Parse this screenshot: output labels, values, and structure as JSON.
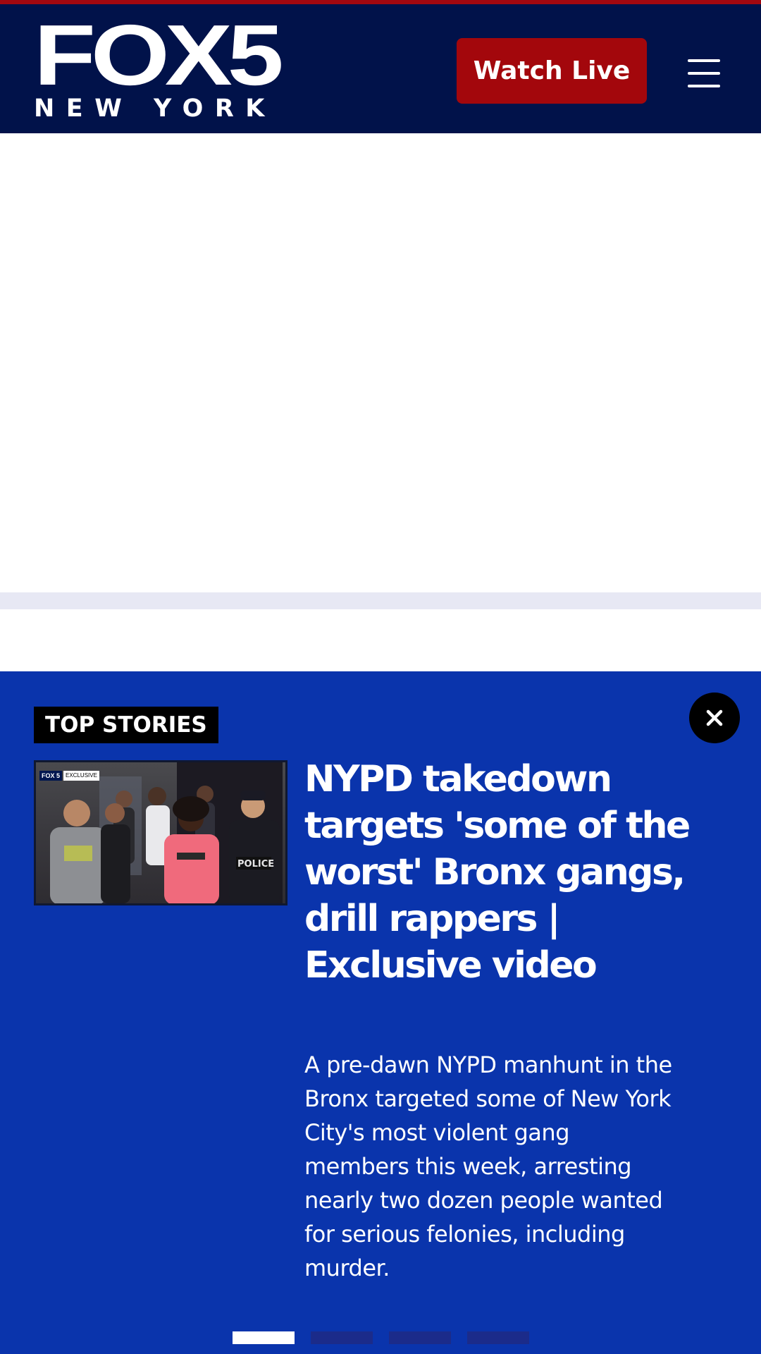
{
  "header": {
    "logo": {
      "main": "FOX5",
      "sub": "NEW YORK"
    },
    "watch_live_label": "Watch Live",
    "menu_icon": "hamburger-menu-icon",
    "background_color": "#01124a",
    "accent_color": "#a2080f"
  },
  "top_stories": {
    "badge": "TOP STORIES",
    "close_icon": "close-icon",
    "background_color": "#0a34ac",
    "story": {
      "thumbnail": {
        "label_brand": "FOX 5",
        "label_tag": "EXCLUSIVE"
      },
      "headline": "NYPD takedown targets 'some of the worst' Bronx gangs, drill rappers | Exclusive video",
      "summary": "A pre-dawn NYPD manhunt in the Bronx targeted some of New York City's most violent gang members this week, arresting nearly two dozen people wanted for serious felonies, including murder."
    },
    "pagination": {
      "total": 4,
      "active": 1
    }
  }
}
